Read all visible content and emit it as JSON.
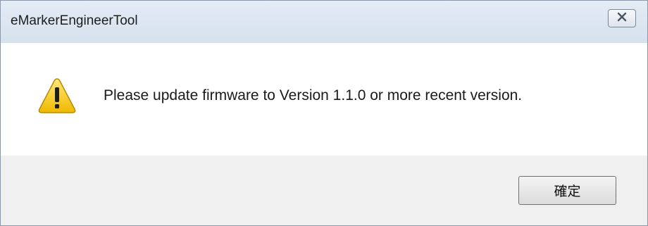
{
  "window": {
    "title": "eMarkerEngineerTool",
    "close_icon": "close-icon"
  },
  "message": {
    "icon": "warning-icon",
    "text": "Please update firmware to Version 1.1.0 or more recent version."
  },
  "buttons": {
    "ok_label": "確定"
  },
  "colors": {
    "warning_yellow": "#f5c400",
    "footer_bg": "#f0f0f0",
    "titlebar_bg": "#dde6f1"
  }
}
